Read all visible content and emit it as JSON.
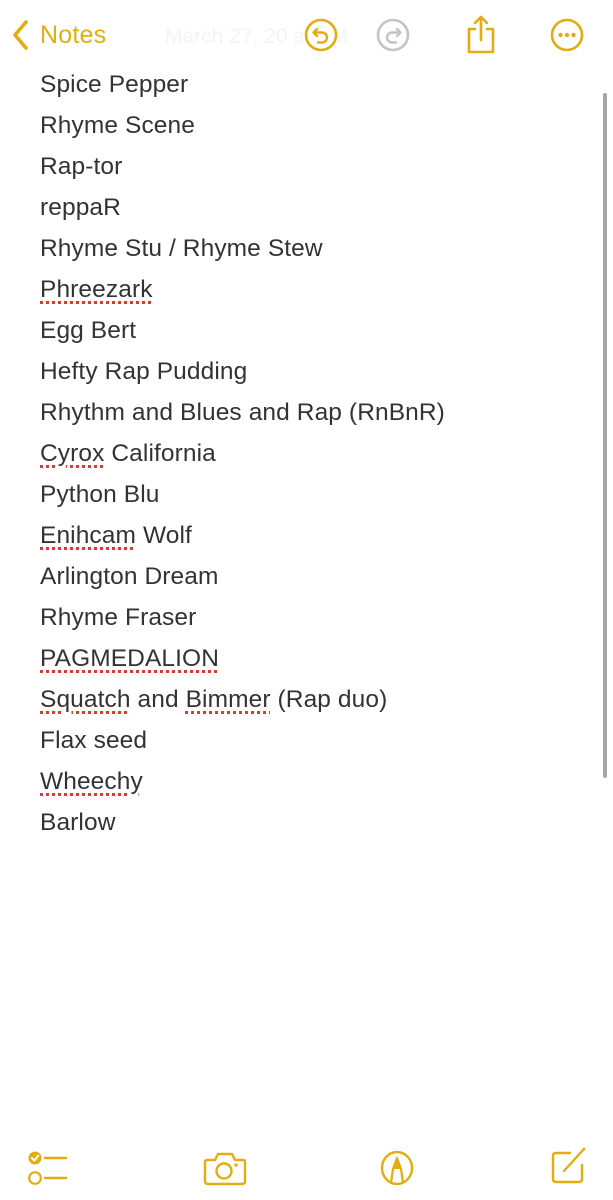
{
  "theme": {
    "accent": "#E2AD10",
    "text": "#333333",
    "disabled": "#c4c4c4",
    "spellcheck": "#e0392b"
  },
  "nav": {
    "back_label": "Notes",
    "date_visible": "March 27, 20     at      PM",
    "icons": {
      "back": "chevron-left-icon",
      "undo": "undo-icon",
      "redo": "redo-icon",
      "share": "share-icon",
      "more": "ellipsis-circle-icon"
    }
  },
  "note": {
    "lines": [
      {
        "segments": [
          {
            "text": "Spice Pepper",
            "misspelled": false
          }
        ]
      },
      {
        "segments": [
          {
            "text": "Rhyme Scene",
            "misspelled": false
          }
        ]
      },
      {
        "segments": [
          {
            "text": "Rap-tor",
            "misspelled": false
          }
        ]
      },
      {
        "segments": [
          {
            "text": "reppaR",
            "misspelled": false
          }
        ]
      },
      {
        "segments": [
          {
            "text": "Rhyme Stu / Rhyme Stew",
            "misspelled": false
          }
        ]
      },
      {
        "segments": [
          {
            "text": "Phreezark",
            "misspelled": true
          }
        ]
      },
      {
        "segments": [
          {
            "text": "Egg Bert",
            "misspelled": false
          }
        ]
      },
      {
        "segments": [
          {
            "text": "Hefty Rap Pudding",
            "misspelled": false
          }
        ]
      },
      {
        "segments": [
          {
            "text": "Rhythm and Blues and Rap (RnBnR)",
            "misspelled": false
          }
        ]
      },
      {
        "segments": [
          {
            "text": "Cyrox",
            "misspelled": true
          },
          {
            "text": " California",
            "misspelled": false
          }
        ]
      },
      {
        "segments": [
          {
            "text": "Python Blu",
            "misspelled": false
          }
        ]
      },
      {
        "segments": [
          {
            "text": "Enihcam",
            "misspelled": true
          },
          {
            "text": " Wolf",
            "misspelled": false
          }
        ]
      },
      {
        "segments": [
          {
            "text": "Arlington Dream",
            "misspelled": false
          }
        ]
      },
      {
        "segments": [
          {
            "text": "Rhyme Fraser",
            "misspelled": false
          }
        ]
      },
      {
        "segments": [
          {
            "text": "PAGMEDALION",
            "misspelled": true
          }
        ]
      },
      {
        "segments": [
          {
            "text": "Squatch",
            "misspelled": true
          },
          {
            "text": " and ",
            "misspelled": false
          },
          {
            "text": "Bimmer",
            "misspelled": true
          },
          {
            "text": " (Rap duo)",
            "misspelled": false
          }
        ]
      },
      {
        "segments": [
          {
            "text": "Flax seed",
            "misspelled": false
          }
        ]
      },
      {
        "segments": [
          {
            "text": "Wheechy",
            "misspelled": true
          }
        ]
      },
      {
        "segments": [
          {
            "text": "Barlow",
            "misspelled": false
          }
        ]
      }
    ]
  },
  "toolbar": {
    "icons": {
      "checklist": "checklist-icon",
      "camera": "camera-icon",
      "markup": "markup-pen-icon",
      "compose": "compose-icon"
    }
  }
}
